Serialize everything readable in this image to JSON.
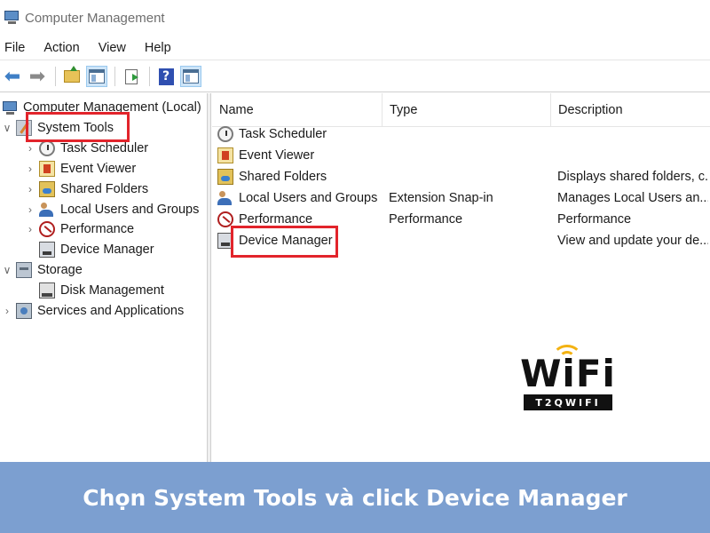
{
  "window": {
    "title": "Computer Management",
    "icon": "computer-management-icon"
  },
  "menu": [
    "File",
    "Action",
    "View",
    "Help"
  ],
  "toolbar": {
    "buttons": [
      "back-arrow-icon",
      "forward-arrow-icon",
      "up-folder-icon",
      "show-hide-tree-icon",
      "export-list-icon",
      "help-icon",
      "show-hide-action-pane-icon"
    ],
    "help_glyph": "?"
  },
  "tree": {
    "root": "Computer Management (Local)",
    "system_tools": "System Tools",
    "task_scheduler": "Task Scheduler",
    "event_viewer": "Event Viewer",
    "shared_folders": "Shared Folders",
    "local_users_groups": "Local Users and Groups",
    "performance": "Performance",
    "device_manager": "Device Manager",
    "storage": "Storage",
    "disk_management": "Disk Management",
    "services_apps": "Services and Applications"
  },
  "list": {
    "columns": {
      "name": "Name",
      "type": "Type",
      "description": "Description"
    },
    "rows": [
      {
        "name": "Task Scheduler",
        "type": "",
        "description": ""
      },
      {
        "name": "Event Viewer",
        "type": "",
        "description": ""
      },
      {
        "name": "Shared Folders",
        "type": "",
        "description": "Displays shared folders, c..."
      },
      {
        "name": "Local Users and Groups",
        "type": "Extension Snap-in",
        "description": "Manages Local Users an..."
      },
      {
        "name": "Performance",
        "type": "Performance",
        "description": "Performance"
      },
      {
        "name": "Device Manager",
        "type": "",
        "description": "View and update your de..."
      }
    ]
  },
  "logo": {
    "word": "WiFi",
    "subtitle": "T2QWIFI"
  },
  "caption": "Chọn System Tools và click Device Manager",
  "colors": {
    "highlight_box": "#e2242b",
    "banner": "#7c9fd0",
    "logo_accent": "#f3b212"
  }
}
